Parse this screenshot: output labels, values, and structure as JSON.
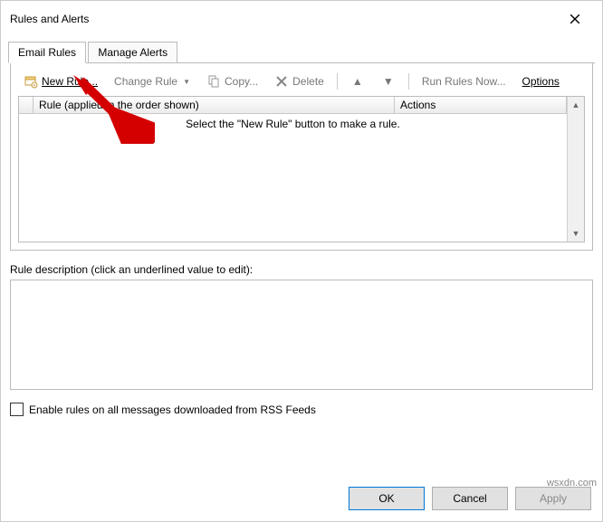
{
  "title": "Rules and Alerts",
  "tabs": {
    "email_rules": "Email Rules",
    "manage_alerts": "Manage Alerts"
  },
  "toolbar": {
    "new_rule": "New Rule...",
    "change_rule": "Change Rule",
    "copy": "Copy...",
    "delete": "Delete",
    "run_rules_now": "Run Rules Now...",
    "options": "Options"
  },
  "grid": {
    "col_rule": "Rule (applied in the order shown)",
    "col_actions": "Actions",
    "empty_message": "Select the \"New Rule\" button to make a rule."
  },
  "description_label": "Rule description (click an underlined value to edit):",
  "rss_checkbox_label": "Enable rules on all messages downloaded from RSS Feeds",
  "buttons": {
    "ok": "OK",
    "cancel": "Cancel",
    "apply": "Apply"
  },
  "watermark": "wsxdn.com"
}
